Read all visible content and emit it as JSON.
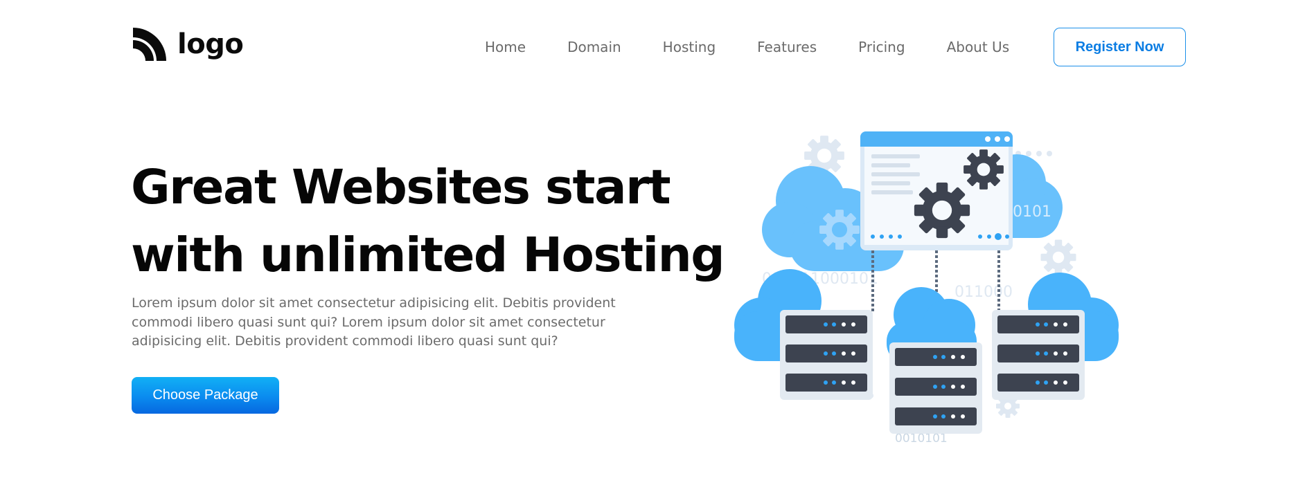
{
  "header": {
    "logo_text": "logo",
    "logo_icon": "wifi-signal-logo-icon",
    "nav": [
      "Home",
      "Domain",
      "Hosting",
      "Features",
      "Pricing",
      "About Us"
    ],
    "register_label": "Register Now"
  },
  "hero": {
    "title_line1": "Great Websites start",
    "title_line2": "with unlimited Hosting",
    "description": "Lorem ipsum dolor sit amet consectetur adipisicing elit. Debitis provident commodi libero quasi sunt qui? Lorem ipsum dolor sit amet consectetur adipisicing elit. Debitis provident commodi libero quasi sunt qui?",
    "cta_label": "Choose Package"
  },
  "illustration": {
    "binary": [
      "0101",
      "001011000101",
      "011000",
      "0010101"
    ],
    "icons": [
      "cloud-icon",
      "server-rack-icon",
      "gear-icon",
      "browser-window-icon"
    ]
  },
  "colors": {
    "accent": "#1b8fe9",
    "cloud": "#4db6fb",
    "server_dark": "#3d4350",
    "text_primary": "#060606",
    "text_secondary": "#6b6b6b"
  }
}
